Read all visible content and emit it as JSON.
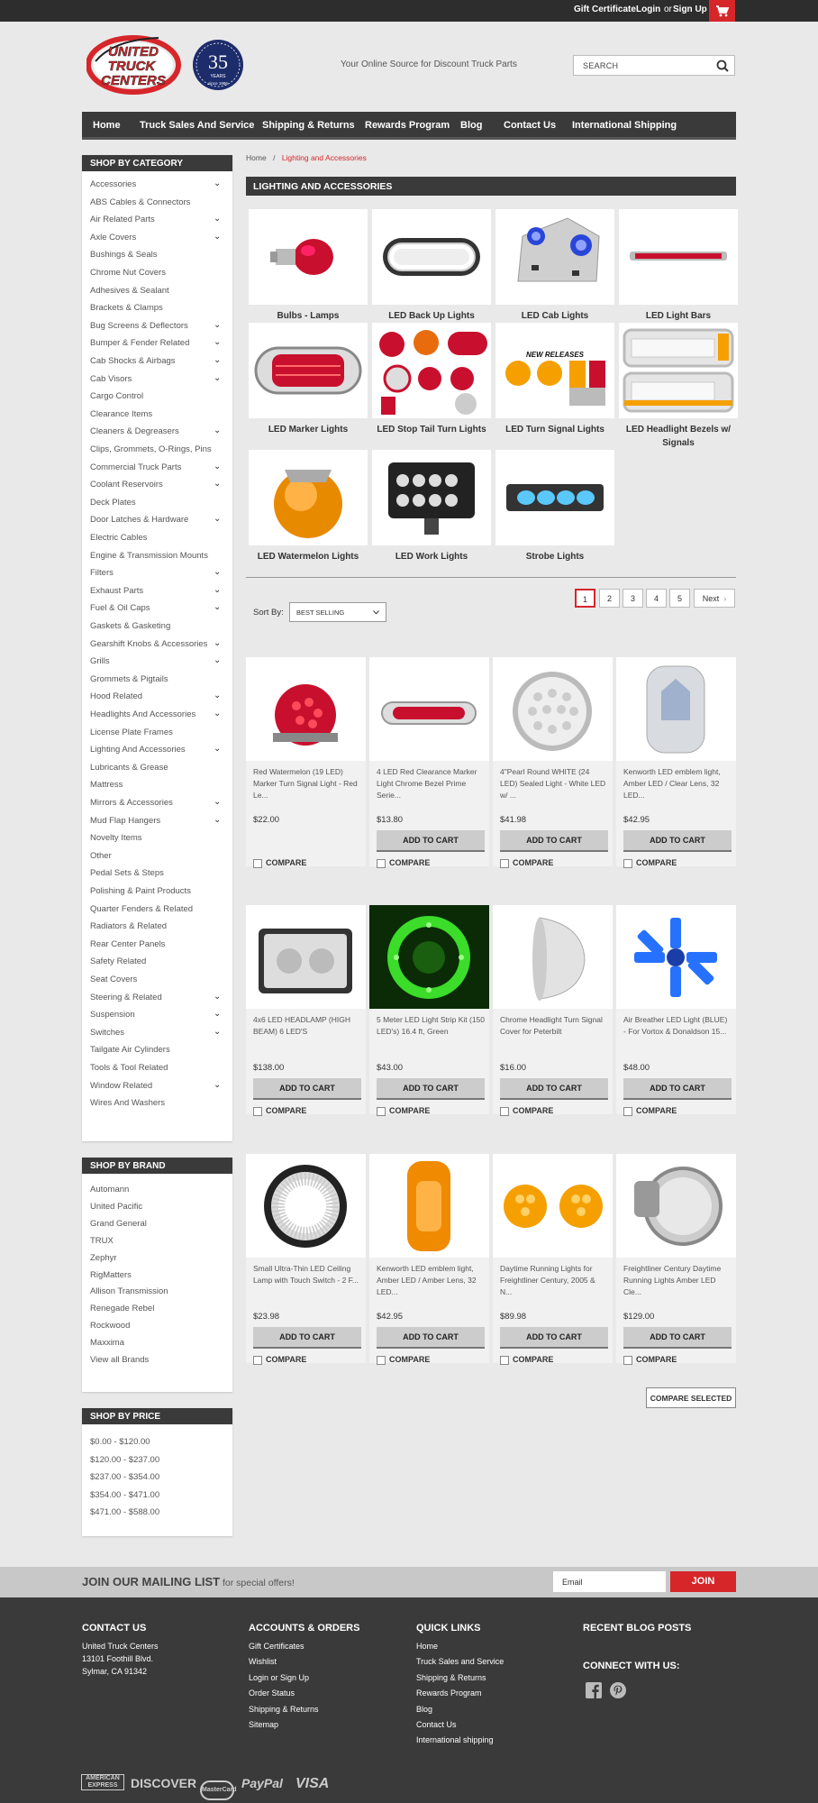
{
  "topbar": {
    "gift": "Gift Certificate",
    "login": "Login",
    "or": "or",
    "signup": "Sign Up"
  },
  "header": {
    "logo_line1": "UNITED",
    "logo_line2": "TRUCK",
    "logo_line3": "CENTERS",
    "badge_number": "35",
    "badge_years": "YEARS",
    "badge_since": "since 1986",
    "tagline": "Your Online Source for Discount Truck Parts",
    "search_placeholder": "SEARCH"
  },
  "nav": [
    "Home",
    "Truck Sales And Service",
    "Shipping & Returns",
    "Rewards Program",
    "Blog",
    "Contact Us",
    "International Shipping"
  ],
  "breadcrumb": {
    "home": "Home",
    "sep": "/",
    "current": "Lighting and Accessories"
  },
  "category_heading": "LIGHTING AND ACCESSORIES",
  "sidebar": {
    "category_title": "SHOP BY CATEGORY",
    "categories": [
      {
        "label": "Accessories",
        "sub": true
      },
      {
        "label": "ABS Cables & Connectors",
        "sub": false
      },
      {
        "label": "Air Related Parts",
        "sub": true
      },
      {
        "label": "Axle Covers",
        "sub": true
      },
      {
        "label": "Bushings & Seals",
        "sub": false
      },
      {
        "label": "Chrome Nut Covers",
        "sub": false
      },
      {
        "label": "Adhesives & Sealant",
        "sub": false
      },
      {
        "label": "Brackets & Clamps",
        "sub": false
      },
      {
        "label": "Bug Screens & Deflectors",
        "sub": true
      },
      {
        "label": "Bumper & Fender Related",
        "sub": true
      },
      {
        "label": "Cab Shocks & Airbags",
        "sub": true
      },
      {
        "label": "Cab Visors",
        "sub": true
      },
      {
        "label": "Cargo Control",
        "sub": false
      },
      {
        "label": "Clearance Items",
        "sub": false
      },
      {
        "label": "Cleaners & Degreasers",
        "sub": true
      },
      {
        "label": "Clips, Grommets, O-Rings, Pins",
        "sub": false
      },
      {
        "label": "Commercial Truck Parts",
        "sub": true
      },
      {
        "label": "Coolant Reservoirs",
        "sub": true
      },
      {
        "label": "Deck Plates",
        "sub": false
      },
      {
        "label": "Door Latches & Hardware",
        "sub": true
      },
      {
        "label": "Electric Cables",
        "sub": false
      },
      {
        "label": "Engine & Transmission Mounts",
        "sub": false
      },
      {
        "label": "Filters",
        "sub": true
      },
      {
        "label": "Exhaust Parts",
        "sub": true
      },
      {
        "label": "Fuel & Oil Caps",
        "sub": true
      },
      {
        "label": "Gaskets & Gasketing",
        "sub": false
      },
      {
        "label": "Gearshift Knobs & Accessories",
        "sub": true
      },
      {
        "label": "Grills",
        "sub": true
      },
      {
        "label": "Grommets & Pigtails",
        "sub": false
      },
      {
        "label": "Hood Related",
        "sub": true
      },
      {
        "label": "Headlights And Accessories",
        "sub": true
      },
      {
        "label": "License Plate Frames",
        "sub": false
      },
      {
        "label": "Lighting And Accessories",
        "sub": true
      },
      {
        "label": "Lubricants & Grease",
        "sub": false
      },
      {
        "label": "Mattress",
        "sub": false
      },
      {
        "label": "Mirrors & Accessories",
        "sub": true
      },
      {
        "label": "Mud Flap Hangers",
        "sub": true
      },
      {
        "label": "Novelty Items",
        "sub": false
      },
      {
        "label": "Other",
        "sub": false
      },
      {
        "label": "Pedal Sets & Steps",
        "sub": false
      },
      {
        "label": "Polishing & Paint Products",
        "sub": false
      },
      {
        "label": "Quarter Fenders & Related",
        "sub": false
      },
      {
        "label": "Radiators & Related",
        "sub": false
      },
      {
        "label": "Rear Center Panels",
        "sub": false
      },
      {
        "label": "Safety Related",
        "sub": false
      },
      {
        "label": "Seat Covers",
        "sub": false
      },
      {
        "label": "Steering & Related",
        "sub": true
      },
      {
        "label": "Suspension",
        "sub": true
      },
      {
        "label": "Switches",
        "sub": true
      },
      {
        "label": "Tailgate Air Cylinders",
        "sub": false
      },
      {
        "label": "Tools & Tool Related",
        "sub": false
      },
      {
        "label": "Window Related",
        "sub": true
      },
      {
        "label": "Wires And Washers",
        "sub": false
      }
    ],
    "brand_title": "SHOP BY BRAND",
    "brands": [
      "Automann",
      "United Pacific",
      "Grand General",
      "TRUX",
      "Zephyr",
      "RigMatters",
      "Allison Transmission",
      "Renegade Rebel",
      "Rockwood",
      "Maxxima",
      "View all Brands"
    ],
    "price_title": "SHOP BY PRICE",
    "prices": [
      "$0.00 - $120.00",
      "$120.00 - $237.00",
      "$237.00 - $354.00",
      "$354.00 - $471.00",
      "$471.00 - $588.00"
    ]
  },
  "subcategories": [
    {
      "label": "Bulbs - Lamps"
    },
    {
      "label": "LED Back Up Lights"
    },
    {
      "label": "LED Cab Lights"
    },
    {
      "label": "LED Light Bars"
    },
    {
      "label": "LED Marker Lights"
    },
    {
      "label": "LED Stop Tail Turn Lights",
      "caption": "NEW RELEASES"
    },
    {
      "label": "LED Turn Signal Lights"
    },
    {
      "label": "LED Headlight Bezels w/ Signals"
    },
    {
      "label": "LED Watermelon Lights"
    },
    {
      "label": "LED Work Lights"
    },
    {
      "label": "Strobe Lights"
    }
  ],
  "sort": {
    "label": "Sort By:",
    "value": "BEST SELLING"
  },
  "pagination": [
    "1",
    "2",
    "3",
    "4",
    "5",
    "Next"
  ],
  "products": [
    {
      "name": "Red Watermelon (19 LED) Marker Turn Signal Light - Red Le...",
      "price": "$22.00",
      "button": "",
      "compare": "COMPARE"
    },
    {
      "name": "4 LED Red Clearance Marker Light Chrome Bezel Prime Serie...",
      "price": "$13.80",
      "button": "ADD TO CART",
      "compare": "COMPARE"
    },
    {
      "name": "4\"Pearl Round WHITE (24 LED) Sealed Light - White LED w/ ...",
      "price": "$41.98",
      "button": "ADD TO CART",
      "compare": "COMPARE"
    },
    {
      "name": "Kenworth LED emblem light, Amber LED / Clear Lens, 32 LED...",
      "price": "$42.95",
      "button": "ADD TO CART",
      "compare": "COMPARE"
    },
    {
      "name": "4x6 LED HEADLAMP (HIGH BEAM) 6 LED'S",
      "price": "$138.00",
      "button": "ADD TO CART",
      "compare": "COMPARE"
    },
    {
      "name": "5 Meter LED Light Strip Kit (150 LED's) 16.4 ft, Green",
      "price": "$43.00",
      "button": "ADD TO CART",
      "compare": "COMPARE"
    },
    {
      "name": "Chrome Headlight Turn Signal Cover for Peterbilt",
      "price": "$16.00",
      "button": "ADD TO CART",
      "compare": "COMPARE"
    },
    {
      "name": "Air Breather LED Light (BLUE) - For Vortox & Donaldson 15...",
      "price": "$48.00",
      "button": "ADD TO CART",
      "compare": "COMPARE"
    },
    {
      "name": "Small Ultra-Thin LED Ceiling Lamp with Touch Switch - 2 F...",
      "price": "$23.98",
      "button": "ADD TO CART",
      "compare": "COMPARE"
    },
    {
      "name": "Kenworth LED emblem light, Amber LED / Amber Lens, 32 LED...",
      "price": "$42.95",
      "button": "ADD TO CART",
      "compare": "COMPARE"
    },
    {
      "name": "Daytime Running Lights for Freightliner Century, 2005 & N...",
      "price": "$89.98",
      "button": "ADD TO CART",
      "compare": "COMPARE"
    },
    {
      "name": "Freightliner Century Daytime Running Lights Amber LED Cle...",
      "price": "$129.00",
      "button": "ADD TO CART",
      "compare": "COMPARE"
    }
  ],
  "compare_selected": "COMPARE SELECTED",
  "mailing": {
    "title": "JOIN OUR MAILING LIST",
    "subtitle": "for special offers!",
    "placeholder": "Email",
    "button": "JOIN"
  },
  "footer": {
    "contact_title": "CONTACT US",
    "contact_lines": [
      "United Truck Centers",
      "13101 Foothill Blvd.",
      "Sylmar, CA 91342"
    ],
    "accounts_title": "ACCOUNTS & ORDERS",
    "accounts_links": [
      "Gift Certificates",
      "Wishlist",
      "Login or Sign Up",
      "Order Status",
      "Shipping & Returns",
      "Sitemap"
    ],
    "quick_title": "QUICK LINKS",
    "quick_links": [
      "Home",
      "Truck Sales and Service",
      "Shipping & Returns",
      "Rewards Program",
      "Blog",
      "Contact Us",
      "International shipping"
    ],
    "blog_title": "RECENT BLOG POSTS",
    "connect_title": "CONNECT WITH US:",
    "payments": [
      "AMERICAN EXPRESS",
      "DISCOVER",
      "MasterCard",
      "PayPal",
      "VISA"
    ]
  },
  "colors": {
    "accent": "#d6262a",
    "dark": "#3a3a3a",
    "background": "#e9e9e9"
  }
}
